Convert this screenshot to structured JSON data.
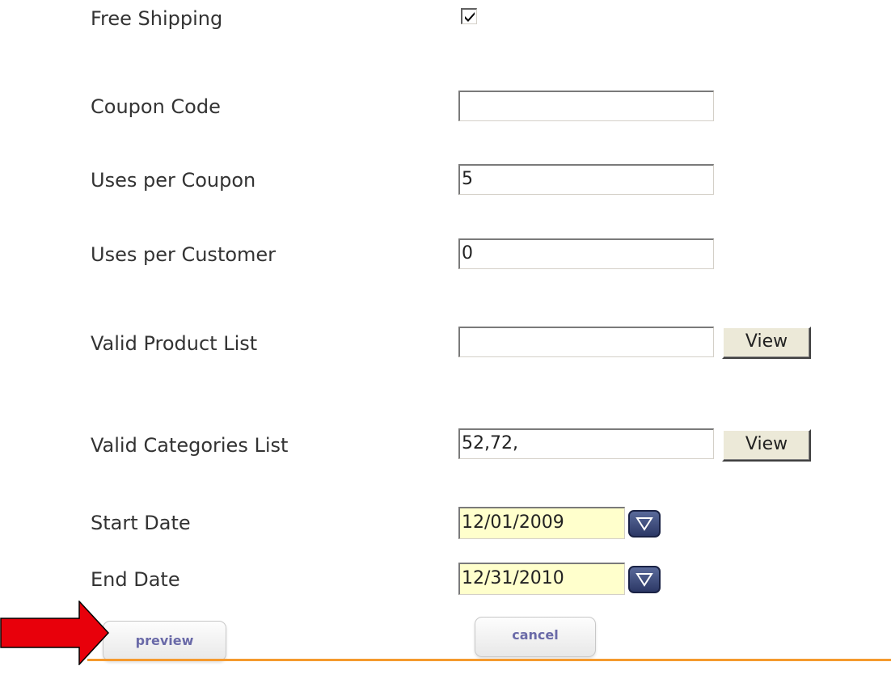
{
  "form": {
    "free_shipping_label": "Free Shipping",
    "free_shipping_checked": true,
    "coupon_code_label": "Coupon Code",
    "coupon_code_value": "",
    "uses_per_coupon_label": "Uses per Coupon",
    "uses_per_coupon_value": "5",
    "uses_per_customer_label": "Uses per Customer",
    "uses_per_customer_value": "0",
    "valid_product_list_label": "Valid Product List",
    "valid_product_list_value": "",
    "valid_categories_list_label": "Valid Categories List",
    "valid_categories_list_value": "52,72,",
    "view_label": "View",
    "start_date_label": "Start Date",
    "start_date_value": "12/01/2009",
    "end_date_label": "End Date",
    "end_date_value": "12/31/2010"
  },
  "actions": {
    "preview_label": "preview",
    "cancel_label": "cancel"
  },
  "icons": {
    "checkbox": "checkmark-icon",
    "calendar_dropdown": "triangle-down-icon",
    "annotation": "red-arrow-icon"
  },
  "colors": {
    "date_field_bg": "#ffffcc",
    "divider": "#f59a2e",
    "annotation_arrow": "#e8000b",
    "action_text": "#6a6aa8"
  }
}
